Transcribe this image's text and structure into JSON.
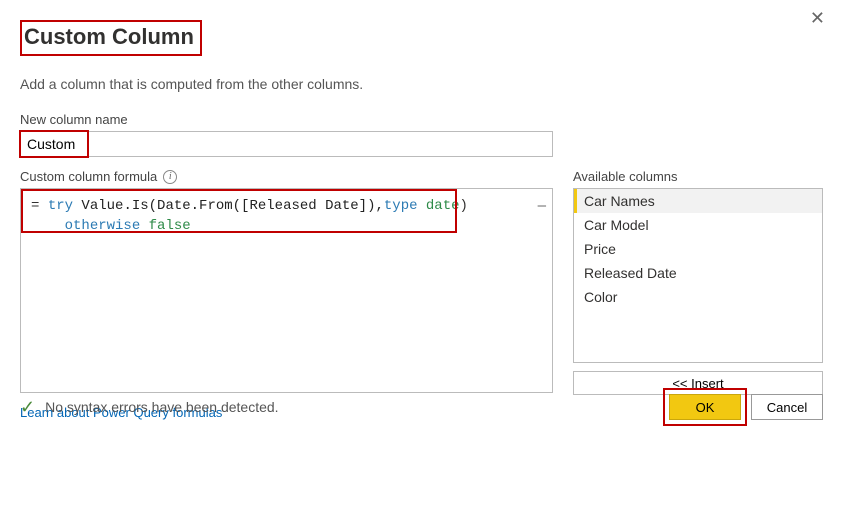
{
  "header": {
    "title": "Custom Column",
    "subtitle": "Add a column that is computed from the other columns."
  },
  "name_field": {
    "label": "New column name",
    "value": "Custom"
  },
  "formula_field": {
    "label": "Custom column formula",
    "eq": "=",
    "kw_try": "try",
    "fn_text": " Value.Is(Date.From([Released Date]),",
    "type_kw": "type",
    "date_kw": " date",
    "close_paren": ")",
    "indent": "    ",
    "kw_otherwise": "otherwise",
    "space": " ",
    "val_false": "false"
  },
  "available": {
    "label": "Available columns",
    "items": [
      "Car Names",
      "Car Model",
      "Price",
      "Released Date",
      "Color"
    ],
    "selected_index": 0,
    "insert_label": "<<  Insert"
  },
  "link": {
    "text": "Learn about Power Query formulas"
  },
  "status": {
    "text": "No syntax errors have been detected."
  },
  "buttons": {
    "ok": "OK",
    "cancel": "Cancel"
  }
}
